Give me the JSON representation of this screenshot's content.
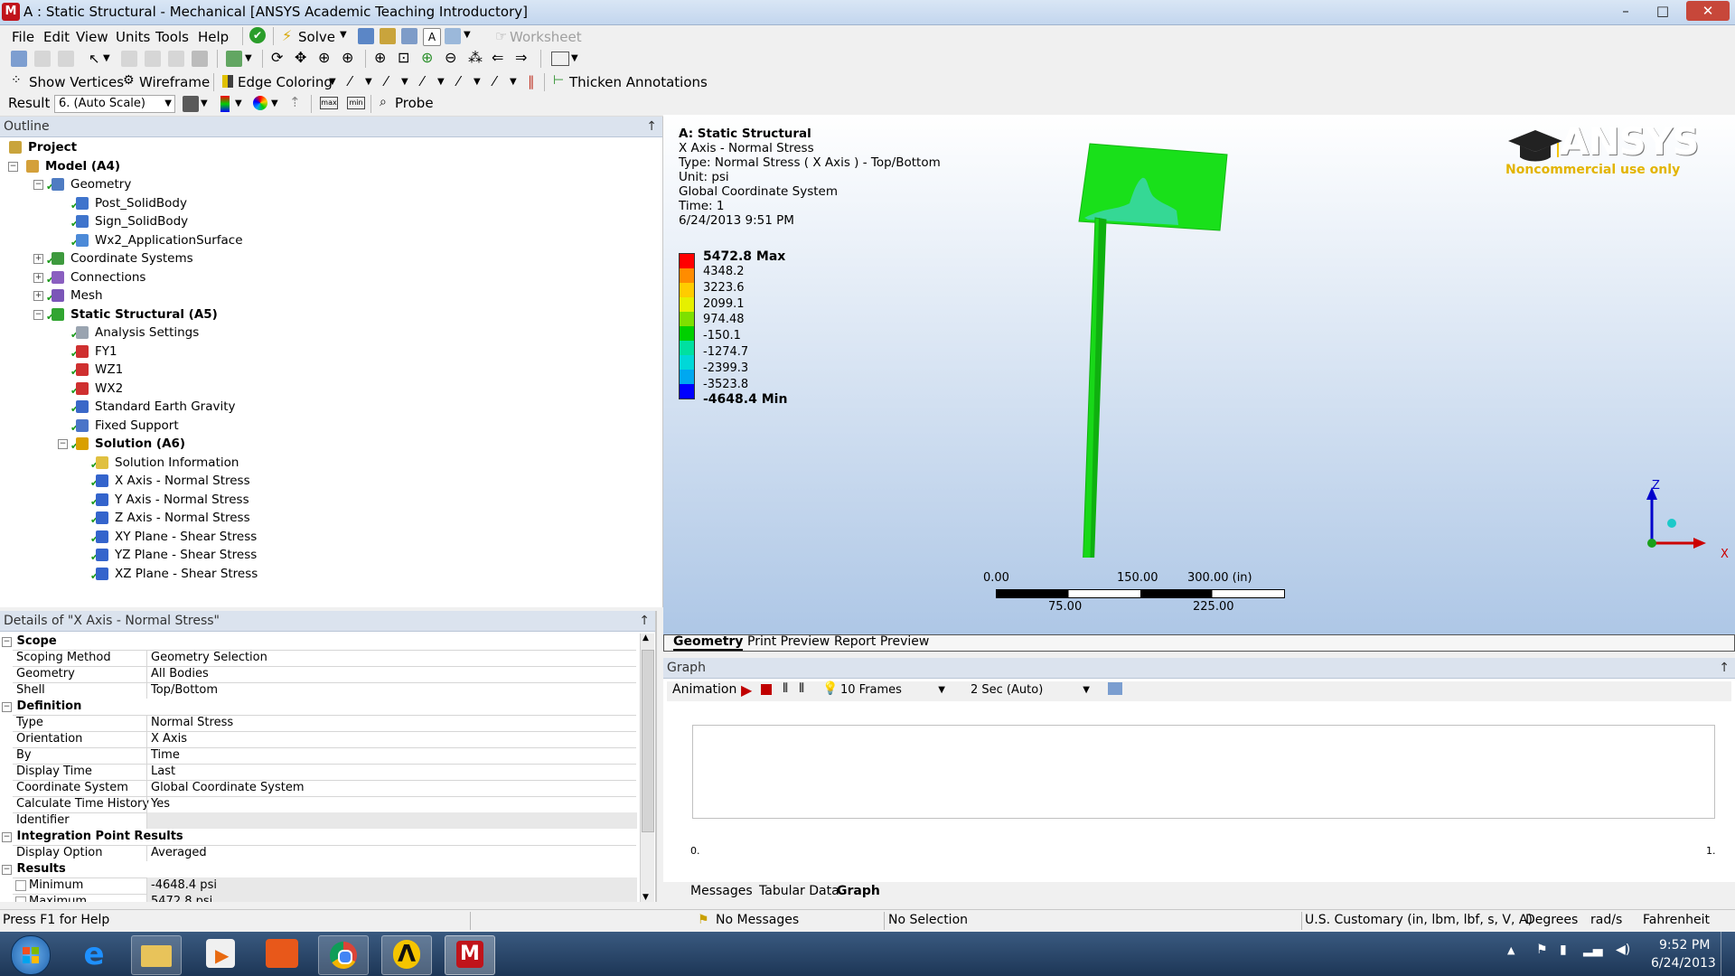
{
  "app": {
    "title": "A : Static Structural - Mechanical [ANSYS Academic Teaching Introductory]",
    "icon_letter": "M"
  },
  "window_controls": {
    "minimize": "–",
    "maximize": "□",
    "close": "✕"
  },
  "menubar": [
    "File",
    "Edit",
    "View",
    "Units",
    "Tools",
    "Help"
  ],
  "toolbar1": {
    "solve_label": "Solve",
    "worksheet_label": "Worksheet"
  },
  "toolbar2": {
    "show_vertices": "Show Vertices",
    "wireframe": "Wireframe",
    "edge_coloring": "Edge Coloring",
    "thicken_annotations": "Thicken Annotations"
  },
  "toolbar3": {
    "result_label": "Result",
    "scale_value": "6. (Auto Scale)",
    "probe_label": "Probe"
  },
  "outline": {
    "header": "Outline",
    "pin": "↑",
    "items": [
      {
        "label": "Project",
        "bold": true,
        "level": 0,
        "icon": "project-icon"
      },
      {
        "label": "Model (A4)",
        "bold": true,
        "level": 1,
        "icon": "model-icon"
      },
      {
        "label": "Geometry",
        "bold": false,
        "level": 2,
        "icon": "geometry-icon"
      },
      {
        "label": "Post_SolidBody",
        "bold": false,
        "level": 3,
        "icon": "solid-body-icon"
      },
      {
        "label": "Sign_SolidBody",
        "bold": false,
        "level": 3,
        "icon": "solid-body-icon"
      },
      {
        "label": "Wx2_ApplicationSurface",
        "bold": false,
        "level": 3,
        "icon": "surface-body-icon"
      },
      {
        "label": "Coordinate Systems",
        "bold": false,
        "level": 2,
        "icon": "coordinate-systems-icon"
      },
      {
        "label": "Connections",
        "bold": false,
        "level": 2,
        "icon": "connections-icon"
      },
      {
        "label": "Mesh",
        "bold": false,
        "level": 2,
        "icon": "mesh-icon"
      },
      {
        "label": "Static Structural (A5)",
        "bold": true,
        "level": 2,
        "icon": "static-structural-icon"
      },
      {
        "label": "Analysis Settings",
        "bold": false,
        "level": 3,
        "icon": "analysis-settings-icon"
      },
      {
        "label": "FY1",
        "bold": false,
        "level": 3,
        "icon": "force-icon"
      },
      {
        "label": "WZ1",
        "bold": false,
        "level": 3,
        "icon": "force-icon"
      },
      {
        "label": "WX2",
        "bold": false,
        "level": 3,
        "icon": "force-icon"
      },
      {
        "label": "Standard Earth Gravity",
        "bold": false,
        "level": 3,
        "icon": "gravity-icon"
      },
      {
        "label": "Fixed Support",
        "bold": false,
        "level": 3,
        "icon": "fixed-support-icon"
      },
      {
        "label": "Solution (A6)",
        "bold": true,
        "level": 3,
        "icon": "solution-icon"
      },
      {
        "label": "Solution Information",
        "bold": false,
        "level": 4,
        "icon": "solution-information-icon"
      },
      {
        "label": "X Axis - Normal Stress",
        "bold": false,
        "level": 4,
        "icon": "result-icon"
      },
      {
        "label": "Y Axis - Normal Stress",
        "bold": false,
        "level": 4,
        "icon": "result-icon"
      },
      {
        "label": "Z Axis - Normal Stress",
        "bold": false,
        "level": 4,
        "icon": "result-icon"
      },
      {
        "label": "XY Plane - Shear Stress",
        "bold": false,
        "level": 4,
        "icon": "result-icon"
      },
      {
        "label": "YZ Plane - Shear Stress",
        "bold": false,
        "level": 4,
        "icon": "result-icon"
      },
      {
        "label": "XZ Plane - Shear Stress",
        "bold": false,
        "level": 4,
        "icon": "result-icon"
      }
    ]
  },
  "details": {
    "header": "Details of \"X Axis - Normal Stress\"",
    "pin": "↑",
    "sections": [
      {
        "title": "Scope",
        "rows": [
          {
            "key": "Scoping Method",
            "value": "Geometry Selection"
          },
          {
            "key": "Geometry",
            "value": "All Bodies"
          },
          {
            "key": "Shell",
            "value": "Top/Bottom"
          }
        ]
      },
      {
        "title": "Definition",
        "rows": [
          {
            "key": "Type",
            "value": "Normal Stress"
          },
          {
            "key": "Orientation",
            "value": "X Axis"
          },
          {
            "key": "By",
            "value": "Time"
          },
          {
            "key": "Display Time",
            "value": "Last"
          },
          {
            "key": "Coordinate System",
            "value": "Global Coordinate System"
          },
          {
            "key": "Calculate Time History",
            "value": "Yes"
          },
          {
            "key": "Identifier",
            "value": ""
          }
        ]
      },
      {
        "title": "Integration Point Results",
        "rows": [
          {
            "key": "Display Option",
            "value": "Averaged"
          }
        ]
      },
      {
        "title": "Results",
        "rows": [
          {
            "key": "Minimum",
            "value": "-4648.4 psi"
          },
          {
            "key": "Maximum",
            "value": "5472.8 psi"
          }
        ]
      }
    ]
  },
  "viewport": {
    "info": [
      "A: Static Structural",
      "X Axis - Normal Stress",
      "Type: Normal Stress ( X Axis ) - Top/Bottom",
      "Unit: psi",
      "Global Coordinate System",
      "Time: 1",
      "6/24/2013 9:51 PM"
    ],
    "legend": {
      "max_label": "5472.8 Max",
      "min_label": "-4648.4 Min",
      "values": [
        "4348.2",
        "3223.6",
        "2099.1",
        "974.48",
        "-150.1",
        "-1274.7",
        "-2399.3",
        "-3523.8"
      ],
      "colors": [
        "#ff0000",
        "#ff8c00",
        "#ffcc00",
        "#e6f000",
        "#7ee000",
        "#00d000",
        "#00e0a0",
        "#00d8d8",
        "#00a8f0",
        "#0000ff"
      ]
    },
    "logo": {
      "text": "ANSYS",
      "subtitle": "Noncommercial use only"
    },
    "scale": {
      "top": [
        "0.00",
        "150.00",
        "300.00 (in)"
      ],
      "bottom": [
        "75.00",
        "225.00"
      ]
    },
    "triad": {
      "z": "Z",
      "x": "X"
    }
  },
  "viewtabs": [
    "Geometry",
    "Print Preview",
    "Report Preview"
  ],
  "graph": {
    "header": "Graph",
    "pin": "↑",
    "animation_label": "Animation",
    "frames": "10 Frames",
    "duration": "2 Sec (Auto)",
    "x_min": "0.",
    "x_max": "1."
  },
  "bottomtabs": [
    "Messages",
    "Tabular Data",
    "Graph"
  ],
  "status": {
    "help": "Press F1 for Help",
    "messages": "No Messages",
    "selection": "No Selection",
    "units": "U.S. Customary (in, lbm, lbf, s, V, A)",
    "angle": "Degrees",
    "rate": "rad/s",
    "temperature": "Fahrenheit"
  },
  "taskbar": {
    "time": "9:52 PM",
    "date": "6/24/2013",
    "apps": [
      "windows-start-icon",
      "internet-explorer-icon",
      "file-explorer-icon",
      "media-player-icon",
      "office-icon",
      "chrome-icon",
      "ansys-workbench-icon",
      "mechanical-icon"
    ]
  },
  "colors": {
    "model_green": "#19e01a",
    "legend_max": "#ff0000",
    "legend_min": "#0000ff",
    "logo_yellow": "#f5c400"
  }
}
